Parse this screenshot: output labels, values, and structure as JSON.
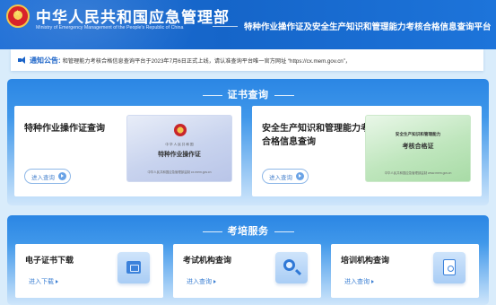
{
  "header": {
    "org_name_cn": "中华人民共和国应急管理部",
    "org_name_en": "Ministry of Emergency Management of the People's Republic of China",
    "platform_title": "特种作业操作证及安全生产知识和管理能力考核合格信息查询平台"
  },
  "notice": {
    "label": "通知公告:",
    "text": "和管理能力考核合格信息查询平台于2023年7月6日正式上线，请认准查询平台唯一官方网址 “https://cx.mem.gov.cn”，"
  },
  "cert_section": {
    "title": "证书查询",
    "cards": [
      {
        "title": "特种作业操作证查询",
        "button": "进入查询",
        "image_sub": "中 华 人 民 共 和 国",
        "image_main": "特种作业操作证",
        "image_foot": "中华人民共和国应急管理部监制  cx.mem.gov.cn"
      },
      {
        "title": "安全生产知识和管理能力考核合格信息查询",
        "button": "进入查询",
        "image_sub": "安全生产知识和管理能力",
        "image_main": "考核合格证",
        "image_foot": "中华人民共和国应急管理部监制  www.mem.gov.cn"
      }
    ]
  },
  "service_section": {
    "title": "考培服务",
    "cards": [
      {
        "title": "电子证书下载",
        "link": "进入下载",
        "icon": "certificate-download-icon"
      },
      {
        "title": "考试机构查询",
        "link": "进入查询",
        "icon": "search-icon"
      },
      {
        "title": "培训机构查询",
        "link": "进入查询",
        "icon": "document-search-icon"
      }
    ]
  },
  "colors": {
    "header_blue": "#1565c9",
    "panel_blue": "#2b86e4",
    "link_blue": "#3b7fd3",
    "notice_blue": "#1a63c8"
  }
}
